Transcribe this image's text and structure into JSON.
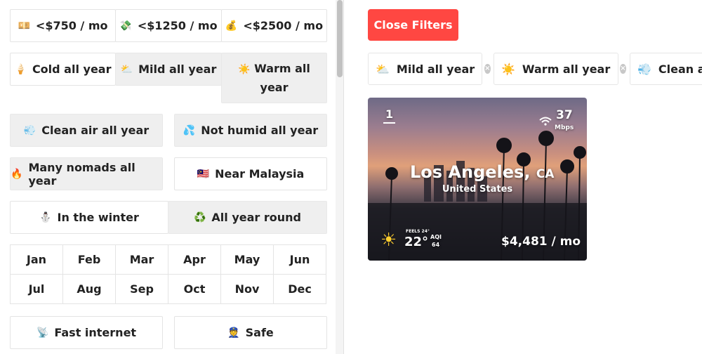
{
  "price_filters": [
    {
      "icon": "💴",
      "label": "<$750 / mo"
    },
    {
      "icon": "💸",
      "label": "<$1250 / mo"
    },
    {
      "icon": "💰",
      "label": "<$2500 / mo"
    }
  ],
  "climate_filters": [
    {
      "icon": "🍦",
      "label": "Cold all year"
    },
    {
      "icon": "⛅",
      "label": "Mild all year"
    },
    {
      "icon": "☀️",
      "label": "Warm all year"
    }
  ],
  "air_filters": [
    {
      "icon": "💨",
      "label": "Clean air all year"
    },
    {
      "icon": "💦",
      "label": "Not humid all year"
    }
  ],
  "nomad_filters": [
    {
      "icon": "🔥",
      "label": "Many nomads all year"
    },
    {
      "icon": "🇲🇾",
      "label": "Near Malaysia"
    }
  ],
  "season_filters": [
    {
      "icon": "⛄",
      "label": "In the winter"
    },
    {
      "icon": "♻️",
      "label": "All year round"
    }
  ],
  "months": [
    "Jan",
    "Feb",
    "Mar",
    "Apr",
    "May",
    "Jun",
    "Jul",
    "Aug",
    "Sep",
    "Oct",
    "Nov",
    "Dec"
  ],
  "extra_filters": [
    {
      "icon": "📡",
      "label": "Fast internet"
    },
    {
      "icon": "👮",
      "label": "Safe"
    }
  ],
  "close_filters_label": "Close Filters",
  "active_chips": [
    {
      "icon": "⛅",
      "label": "Mild all year",
      "remove": "×"
    },
    {
      "icon": "☀️",
      "label": "Warm all year",
      "remove": "×"
    },
    {
      "icon": "💨",
      "label": "Clean air"
    }
  ],
  "city_card": {
    "rank": "1",
    "internet_speed": "37",
    "internet_unit": "Mbps",
    "city": "Los Angeles,",
    "state": "CA",
    "country": "United States",
    "weather_icon": "☀",
    "feels_like": "FEELS 24°",
    "temperature": "22°",
    "aqi_label": "AQI",
    "aqi_value": "64",
    "cost": "$4,481 / mo"
  }
}
